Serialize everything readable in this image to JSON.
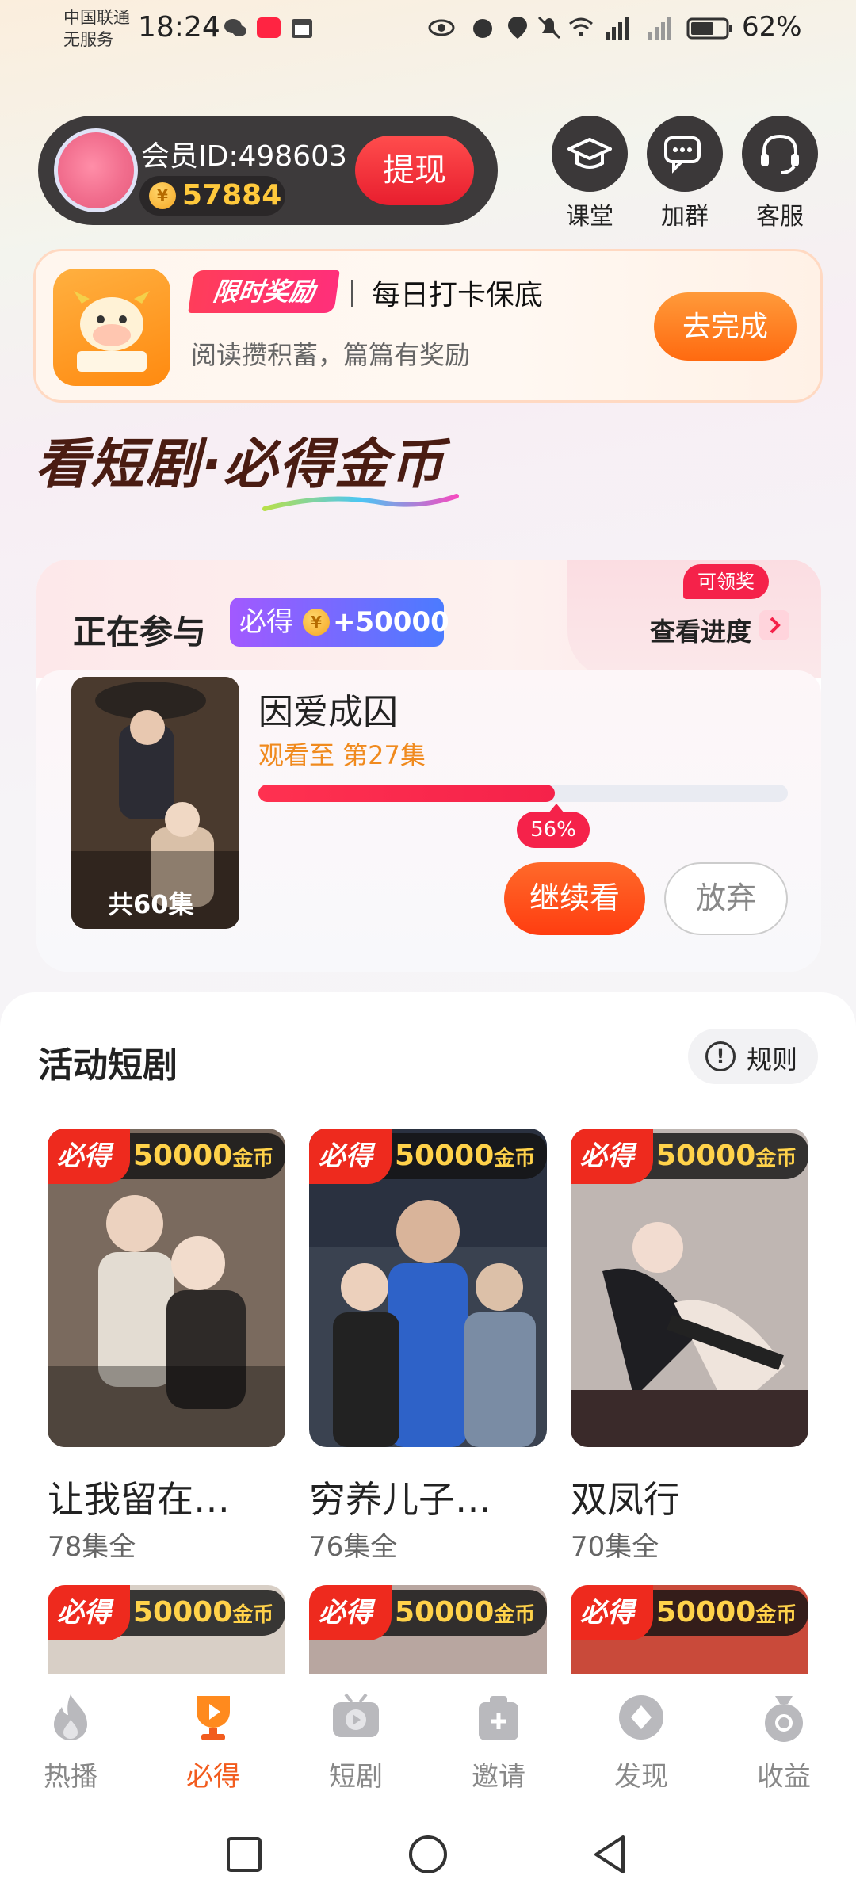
{
  "status_bar": {
    "carrier_line1": "中国联通",
    "carrier_line2": "无服务",
    "time": "18:24",
    "battery": "62%"
  },
  "profile": {
    "member_id": "会员ID:498603",
    "coins": "57884",
    "withdraw_label": "提现"
  },
  "quick_actions": [
    {
      "label": "课堂",
      "icon": "graduation-cap-icon"
    },
    {
      "label": "加群",
      "icon": "chat-group-icon"
    },
    {
      "label": "客服",
      "icon": "headset-icon"
    }
  ],
  "task_banner": {
    "tag": "限时奖励",
    "title": "每日打卡保底",
    "subtitle": "阅读攒积蓄，篇篇有奖励",
    "button": "去完成"
  },
  "headline": "看短剧·必得金币",
  "participating": {
    "label": "正在参与",
    "badge_prefix": "必得",
    "badge_amount": "+50000",
    "progress_link": "查看进度",
    "claim_tag": "可领奖",
    "drama_title": "因爱成囚",
    "watched": "观看至 第27集",
    "poster_episodes": "共60集",
    "percent_label": "56%",
    "percent_value": 56,
    "continue_label": "继续看",
    "quit_label": "放弃"
  },
  "activity": {
    "title": "活动短剧",
    "rules_label": "规则",
    "reward_prefix": "必得",
    "reward_amount": "50000",
    "reward_unit": "金币",
    "items": [
      {
        "name": "让我留在…",
        "episodes": "78集全"
      },
      {
        "name": "穷养儿子…",
        "episodes": "76集全"
      },
      {
        "name": "双凤行",
        "episodes": "70集全"
      }
    ]
  },
  "bottom_nav": [
    {
      "label": "热播",
      "icon": "flame-icon",
      "active": false
    },
    {
      "label": "必得",
      "icon": "trophy-play-icon",
      "active": true
    },
    {
      "label": "短剧",
      "icon": "tv-play-icon",
      "active": false
    },
    {
      "label": "邀请",
      "icon": "gift-plus-icon",
      "active": false
    },
    {
      "label": "发现",
      "icon": "compass-icon",
      "active": false
    },
    {
      "label": "收益",
      "icon": "money-bag-icon",
      "active": false
    }
  ],
  "colors": {
    "accent_red": "#f5224a",
    "accent_orange": "#ff6a10",
    "coin_gold": "#ffc93c",
    "nav_active": "#f25c1e"
  }
}
